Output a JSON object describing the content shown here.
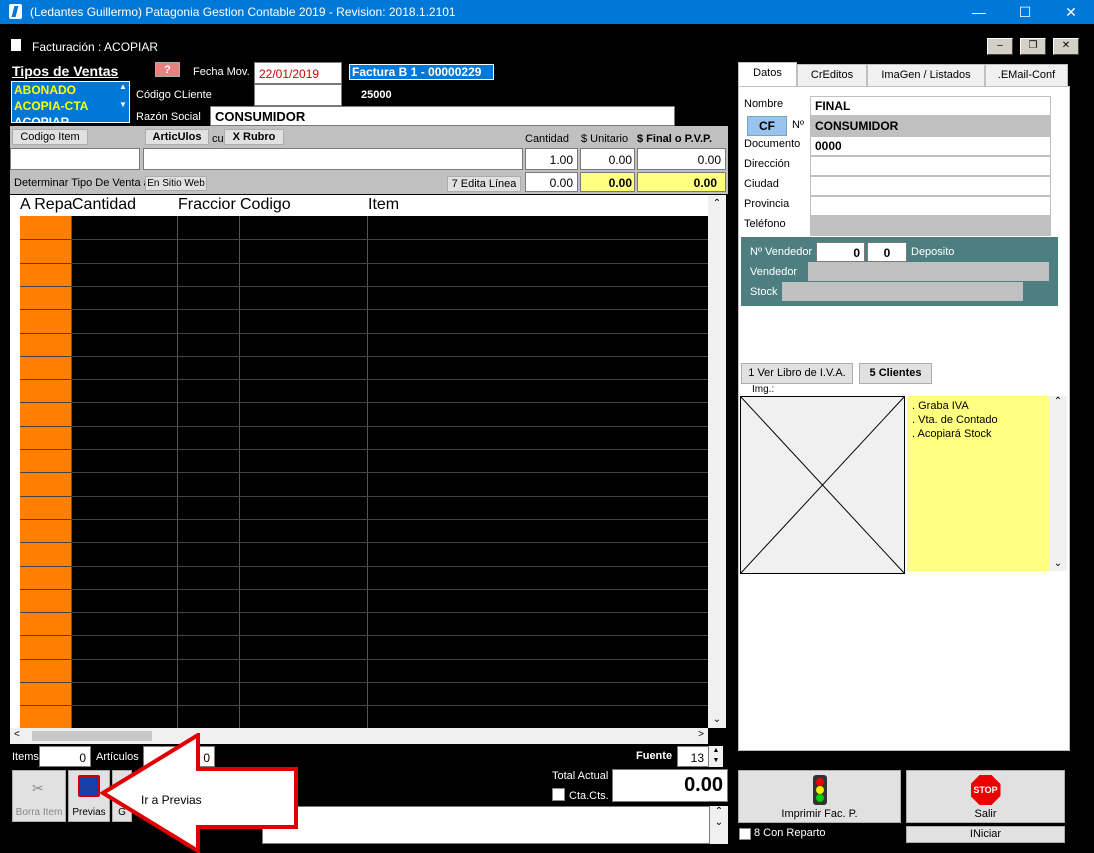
{
  "window": {
    "title": "(Ledantes Guillermo) Patagonia Gestion Contable 2019 - Revision: 2018.1.2101"
  },
  "mdi": {
    "title": "Facturación : ACOPIAR"
  },
  "tipos": {
    "heading": "Tipos de Ventas",
    "items": [
      "ABONADO",
      "ACOPIA-CTA",
      "ACOPIAR"
    ],
    "help": "?"
  },
  "header": {
    "fecha_label": "Fecha Mov.",
    "fecha_value": "22/01/2019",
    "factura": "Factura  B    1 - 00000229",
    "codigo_cliente_label": "Código CLiente",
    "codigo_cliente_value": "25000",
    "razon_social_label": "Razón Social",
    "razon_social_value": "CONSUMIDOR"
  },
  "item_entry": {
    "codigo_item": "Codigo Item",
    "articulos": "ArticUlos",
    "cu": "cu",
    "rubro": "X Rubro",
    "cantidad_label": "Cantidad",
    "unitario_label": "$ Unitario",
    "final_label": "$ Final o P.V.P.",
    "cantidad_value": "1.00",
    "unitario_value": "0.00",
    "final_value": "0.00",
    "determinar": "Determinar Tipo De Venta a",
    "en_sitio": "En Sitio Web",
    "edita": "7 Edita Línea",
    "sum1": "0.00",
    "sum2": "0.00",
    "sum3": "0.00"
  },
  "grid": {
    "columns": [
      "A Repa",
      "Cantidad",
      "Fraccior",
      "Codigo",
      "Item"
    ]
  },
  "bottom": {
    "items_label": "Items",
    "items_value": "0",
    "articulos_label": "Artículos",
    "articulos_value": "0",
    "fuente_label": "Fuente",
    "fuente_value": "13",
    "total_label": "Total Actual",
    "total_value": "0.00",
    "ctacte_label": "Cta.Cts.",
    "borra_item": "Borra Item",
    "previas": "Previas",
    "g": "G",
    "callout": "Ir a Previas"
  },
  "tabs": [
    "Datos",
    "CrEditos",
    "ImaGen / Listados",
    ".EMail-Conf"
  ],
  "datos": {
    "nombre_label": "Nombre",
    "nombre_value": "FINAL",
    "cf": "CF",
    "no": "Nº",
    "no_value": "CONSUMIDOR",
    "documento_label": "Documento",
    "documento_value": "0000",
    "direccion_label": "Dirección",
    "ciudad_label": "Ciudad",
    "provincia_label": "Provincia",
    "telefono_label": "Teléfono"
  },
  "vendedor": {
    "no_label": "Nº Vendedor",
    "no_value": "0",
    "deposito_value": "0",
    "deposito_label": "Deposito",
    "vendedor_label": "Vendedor",
    "stock_label": "Stock"
  },
  "actions": {
    "libro_iva": "1 Ver Libro de I.V.A.",
    "clientes": "5 Clientes",
    "img_label": "Img.:"
  },
  "notes": [
    ". Graba IVA",
    ". Vta. de Contado",
    ". Acopiará Stock"
  ],
  "footer": {
    "imprimir": "Imprimir Fac. P.",
    "salir": "Salir",
    "con_reparto": "8 Con Reparto",
    "iniciar": "INiciar"
  }
}
